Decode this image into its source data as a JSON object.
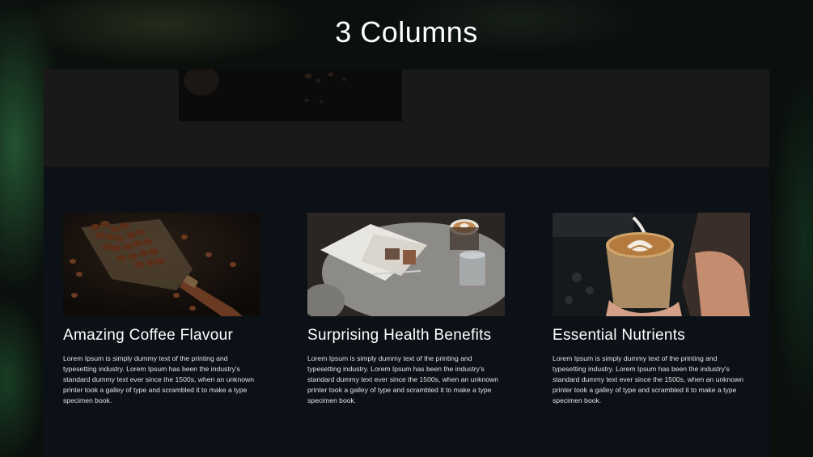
{
  "page": {
    "title": "3 Columns"
  },
  "columns": [
    {
      "title": "Amazing Coffee Flavour",
      "text": "Lorem Ipsum is simply dummy text of the printing and typesetting industry. Lorem Ipsum has been the industry's standard dummy text ever since the 1500s, when an unknown printer took a galley of type and scrambled it to make a type specimen book."
    },
    {
      "title": "Surprising Health Benefits",
      "text": "Lorem Ipsum is simply dummy text of the printing and typesetting industry. Lorem Ipsum has been the industry's standard dummy text ever since the 1500s, when an unknown printer took a galley of type and scrambled it to make a type specimen book."
    },
    {
      "title": "Essential Nutrients",
      "text": "Lorem Ipsum is simply dummy text of the printing and typesetting industry. Lorem Ipsum has been the industry's standard dummy text ever since the 1500s, when an unknown printer took a galley of type and scrambled it to make a type specimen book."
    }
  ],
  "images": {
    "top": "coffee-beans-photo",
    "column_1": "coffee-beans-scoop-photo",
    "column_2": "magazine-and-latte-photo",
    "column_3": "latte-art-pour-photo"
  }
}
